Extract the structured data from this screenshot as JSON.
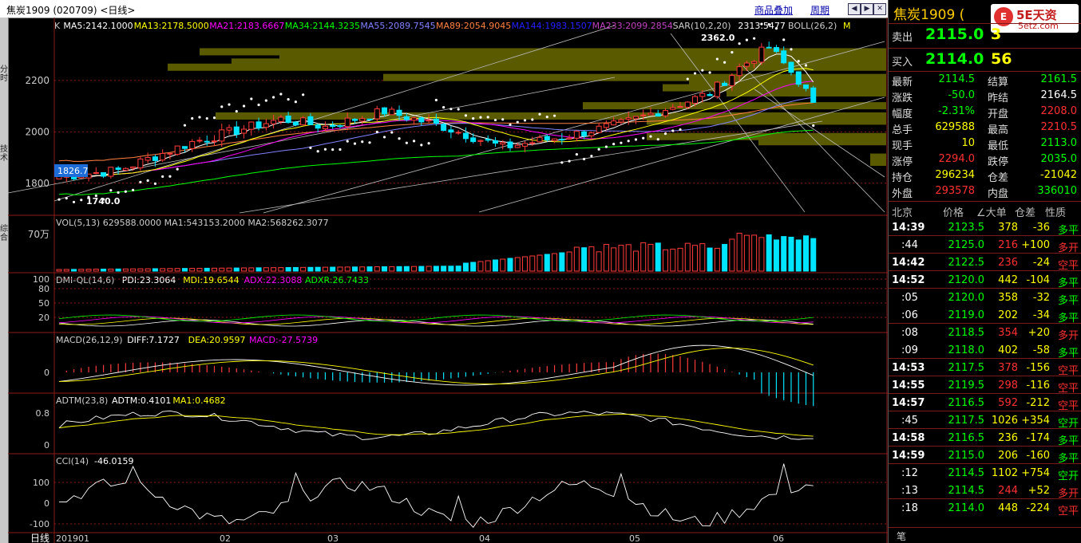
{
  "window": {
    "title": "焦炭1909 (020709) <日线>",
    "overlay_link": "商品叠加",
    "period_link": "周期"
  },
  "left_strip": {
    "labels": [
      "分时",
      "技术",
      "综合"
    ]
  },
  "colors": {
    "up": "#ff3b3b",
    "down": "#00e5ff",
    "ma5": "#ffffff",
    "ma13": "#ffff00",
    "ma21": "#ff00ff",
    "ma34": "#00ff00",
    "ma55": "#8080ff",
    "ma89": "#ff8040",
    "ma144": "#0000ff",
    "ma233": "#c040c0",
    "price_green": "#00ff00",
    "price_red": "#ff3030",
    "accent": "#ffcc00"
  },
  "main_panel": {
    "indicator_line": [
      {
        "text": "K",
        "color": "#cccccc"
      },
      {
        "text": "MA5:2142.1000",
        "color": "#ffffff"
      },
      {
        "text": "MA13:2178.5000",
        "color": "#ffff00"
      },
      {
        "text": "MA21:2183.6667",
        "color": "#ff00ff"
      },
      {
        "text": "MA34:2144.3235",
        "color": "#00ff00"
      },
      {
        "text": "MA55:2089.7545",
        "color": "#8080ff"
      },
      {
        "text": "MA89:2054.9045",
        "color": "#ff8040"
      },
      {
        "text": "MA144:1983.1507",
        "color": "#2020ff"
      },
      {
        "text": "MA233:2099.2854",
        "color": "#c040c0"
      },
      {
        "text": "SAR(10,2,20)",
        "color": "#cccccc"
      },
      {
        "text": "2313.5477",
        "color": "#ffffff"
      },
      {
        "text": "BOLL(26,2)",
        "color": "#cccccc"
      },
      {
        "text": "M",
        "color": "#ffff00"
      }
    ],
    "price_axis": [
      "2200",
      "2000",
      "1800"
    ],
    "high_label": "2362.0",
    "low_label": "1740.0",
    "price_box": "1826.7"
  },
  "volume_panel": {
    "indicator": "VOL(5,13) 629588.0000 MA1:543153.2000 MA2:568262.3077",
    "axis": [
      "70万"
    ]
  },
  "dmi_panel": {
    "name": "DMI-QL(14,6)",
    "pdi": "PDI:23.3064",
    "mdi": "MDI:19.6544",
    "adx": "ADX:22.3088",
    "adxr": "ADXR:26.7433",
    "axis": [
      "100",
      "80",
      "50",
      "20"
    ]
  },
  "macd_panel": {
    "name": "MACD(26,12,9)",
    "diff": "DIFF:7.1727",
    "dea": "DEA:20.9597",
    "macd": "MACD:-27.5739",
    "axis": [
      "0"
    ]
  },
  "adtm_panel": {
    "name": "ADTM(23,8)",
    "adtm": "ADTM:0.4101",
    "ma1": "MA1:0.4682",
    "axis": [
      "0.8",
      "0"
    ]
  },
  "cci_panel": {
    "name": "CCI(14)",
    "value": "-46.0159",
    "axis": [
      "100",
      "0",
      "-100"
    ]
  },
  "x_axis": {
    "period": "日线",
    "dates": [
      "201901",
      "02",
      "03",
      "04",
      "05",
      "06"
    ]
  },
  "right_panel": {
    "title": "焦炭1909 (",
    "logo_text": "5E天资",
    "logo_site": "5etz.com",
    "logo_mark": "E",
    "sell": {
      "label": "卖出",
      "price": "2115.0",
      "qty": "3"
    },
    "buy": {
      "label": "买入",
      "price": "2114.0",
      "qty": "56"
    },
    "stats": [
      {
        "l": "最新",
        "v": "2114.5",
        "vc": "#00ff00",
        "l2": "结算",
        "v2": "2161.5",
        "v2c": "#00ff00"
      },
      {
        "l": "涨跌",
        "v": "-50.0",
        "vc": "#00ff00",
        "l2": "昨结",
        "v2": "2164.5",
        "v2c": "#ffffff"
      },
      {
        "l": "幅度",
        "v": "-2.31%",
        "vc": "#00ff00",
        "l2": "开盘",
        "v2": "2208.0",
        "v2c": "#ff3030"
      },
      {
        "l": "总手",
        "v": "629588",
        "vc": "#ffff00",
        "l2": "最高",
        "v2": "2210.5",
        "v2c": "#ff3030"
      },
      {
        "l": "现手",
        "v": "10",
        "vc": "#ffff00",
        "l2": "最低",
        "v2": "2113.0",
        "v2c": "#00ff00"
      },
      {
        "l": "涨停",
        "v": "2294.0",
        "vc": "#ff3030",
        "l2": "跌停",
        "v2": "2035.0",
        "v2c": "#00ff00"
      },
      {
        "l": "持仓",
        "v": "296234",
        "vc": "#ffff00",
        "l2": "仓差",
        "v2": "-21042",
        "v2c": "#ffff00"
      },
      {
        "l": "外盘",
        "v": "293578",
        "vc": "#ff3030",
        "l2": "内盘",
        "v2": "336010",
        "v2c": "#00ff00"
      }
    ],
    "tick_headers": [
      "北京",
      "价格",
      "∠大单",
      "仓差",
      "性质"
    ],
    "ticks": [
      {
        "t": "14:39",
        "p": "2123.5",
        "q": "378",
        "qc": "#ffff00",
        "d": "-36",
        "n": "多平",
        "nc": "#00ff00"
      },
      {
        "t": ":44",
        "p": "2125.0",
        "q": "216",
        "qc": "#ff3030",
        "d": "+100",
        "n": "多开",
        "nc": "#ff3030"
      },
      {
        "t": "14:42",
        "p": "2122.5",
        "q": "236",
        "qc": "#ff3030",
        "d": "-24",
        "n": "空平",
        "nc": "#ff3030"
      },
      {
        "t": "14:52",
        "p": "2120.0",
        "q": "442",
        "qc": "#ffff00",
        "d": "-104",
        "n": "多平",
        "nc": "#00ff00"
      },
      {
        "t": ":05",
        "p": "2120.0",
        "q": "358",
        "qc": "#ffff00",
        "d": "-32",
        "n": "多平",
        "nc": "#00ff00"
      },
      {
        "t": ":06",
        "p": "2119.0",
        "q": "202",
        "qc": "#ffff00",
        "d": "-34",
        "n": "多平",
        "nc": "#00ff00"
      },
      {
        "t": ":08",
        "p": "2118.5",
        "q": "354",
        "qc": "#ff3030",
        "d": "+20",
        "n": "多开",
        "nc": "#ff3030"
      },
      {
        "t": ":09",
        "p": "2118.0",
        "q": "402",
        "qc": "#ffff00",
        "d": "-58",
        "n": "多平",
        "nc": "#00ff00"
      },
      {
        "t": "14:53",
        "p": "2117.5",
        "q": "378",
        "qc": "#ff3030",
        "d": "-156",
        "n": "空平",
        "nc": "#ff3030"
      },
      {
        "t": "14:55",
        "p": "2119.5",
        "q": "298",
        "qc": "#ff3030",
        "d": "-116",
        "n": "空平",
        "nc": "#ff3030"
      },
      {
        "t": "14:57",
        "p": "2116.5",
        "q": "592",
        "qc": "#ff3030",
        "d": "-212",
        "n": "空平",
        "nc": "#ff3030"
      },
      {
        "t": ":45",
        "p": "2117.5",
        "q": "1026",
        "qc": "#ffff00",
        "d": "+354",
        "n": "空开",
        "nc": "#00ff00"
      },
      {
        "t": "14:58",
        "p": "2116.5",
        "q": "236",
        "qc": "#ffff00",
        "d": "-174",
        "n": "多平",
        "nc": "#00ff00"
      },
      {
        "t": "14:59",
        "p": "2115.0",
        "q": "206",
        "qc": "#ffff00",
        "d": "-160",
        "n": "多平",
        "nc": "#00ff00"
      },
      {
        "t": ":12",
        "p": "2114.5",
        "q": "1102",
        "qc": "#ffff00",
        "d": "+754",
        "n": "空开",
        "nc": "#00ff00"
      },
      {
        "t": ":13",
        "p": "2114.5",
        "q": "244",
        "qc": "#ff3030",
        "d": "+52",
        "n": "多开",
        "nc": "#ff3030"
      },
      {
        "t": ":18",
        "p": "2114.0",
        "q": "448",
        "qc": "#ffff00",
        "d": "-224",
        "n": "空平",
        "nc": "#ff3030"
      }
    ],
    "footer_tab": "笔"
  },
  "chart_data": {
    "type": "candlestick",
    "title": "焦炭1909 (020709) 日线",
    "ylim": [
      1740,
      2362
    ],
    "sessions": 103,
    "first_close": 1826.7,
    "last_close": 2114.5,
    "period_high": 2362.0,
    "period_low": 1740.0
  }
}
